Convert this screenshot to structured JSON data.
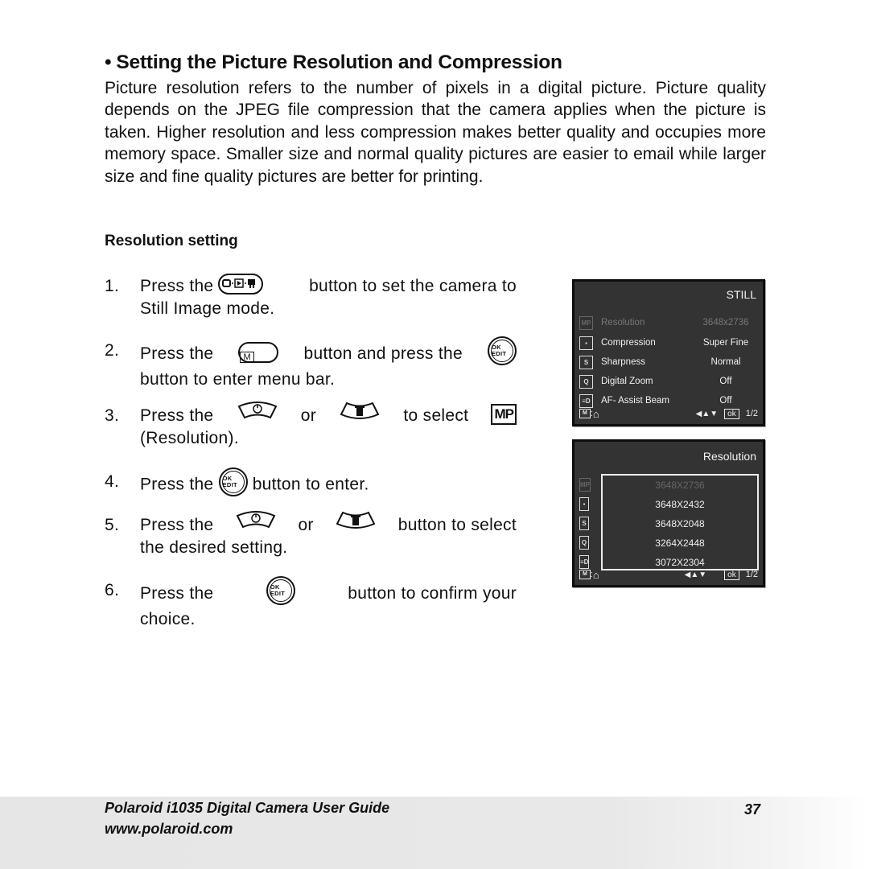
{
  "section": {
    "bullet": "•",
    "title": "Setting the Picture Resolution and Compression",
    "intro": "Picture resolution refers to the number of pixels in a digital picture. Picture quality depends on the JPEG file compression that the camera applies when the picture is taken. Higher resolution and less compression makes better quality and occupies more memory space. Smaller size and normal quality pictures are easier to email while larger size and fine quality pictures are better for printing."
  },
  "subsection": {
    "title": "Resolution setting"
  },
  "steps": [
    {
      "num": "1.",
      "a": "Press the",
      "icon": "mode-button-icon",
      "b": "button to set the camera to",
      "c": "Still Image mode."
    },
    {
      "num": "2.",
      "a": "Press the",
      "icon": "menu-m-button-icon",
      "b": "button and press the",
      "icon2": "ok-edit-button-icon",
      "c": "button to enter menu bar."
    },
    {
      "num": "3.",
      "a": "Press the",
      "icon": "up-arrow-timer-button-icon",
      "or": "or",
      "icon2": "down-arrow-trash-button-icon",
      "b": "to select",
      "icon3": "mp-resolution-icon",
      "c": "(Resolution)."
    },
    {
      "num": "4.",
      "a": "Press the",
      "icon": "ok-edit-button-icon",
      "b": "button to enter."
    },
    {
      "num": "5.",
      "a": "Press the",
      "icon": "up-arrow-timer-button-icon",
      "or": "or",
      "icon2": "down-arrow-trash-button-icon",
      "b": "button to select",
      "c": "the desired setting."
    },
    {
      "num": "6.",
      "a": "Press the",
      "icon": "ok-edit-button-icon",
      "b": "button to confirm your",
      "c": "choice."
    }
  ],
  "icon_text": {
    "ok_top": "OK",
    "ok_bottom": "EDIT",
    "m": "M",
    "mp": "MP"
  },
  "screen1": {
    "header": "STILL",
    "rows": [
      {
        "icon": "mp-icon",
        "icon_text": "MP",
        "label": "Resolution",
        "value": "3648x2736",
        "dimmed": true
      },
      {
        "icon": "compression-icon",
        "icon_text": "▪",
        "label": "Compression",
        "value": "Super Fine",
        "dimmed": false
      },
      {
        "icon": "sharpness-icon",
        "icon_text": "S",
        "label": "Sharpness",
        "value": "Normal",
        "dimmed": false
      },
      {
        "icon": "digital-zoom-icon",
        "icon_text": "Q",
        "label": "Digital Zoom",
        "value": "Off",
        "dimmed": false
      },
      {
        "icon": "af-assist-beam-icon",
        "icon_text": "≡D",
        "label": "AF- Assist Beam",
        "value": "Off",
        "dimmed": false
      }
    ],
    "footer": {
      "m": "M",
      "sep": ":",
      "home": "⌂",
      "nav": "◀▲▼",
      "ok": "ok",
      "page": "1/2"
    }
  },
  "screen2": {
    "header": "Resolution",
    "icons": [
      {
        "icon": "mp-icon",
        "icon_text": "MP",
        "dimmed": true
      },
      {
        "icon": "compression-icon",
        "icon_text": "▪",
        "dimmed": false
      },
      {
        "icon": "sharpness-icon",
        "icon_text": "S",
        "dimmed": false
      },
      {
        "icon": "digital-zoom-icon",
        "icon_text": "Q",
        "dimmed": false
      },
      {
        "icon": "af-assist-beam-icon",
        "icon_text": "≡D",
        "dimmed": false
      }
    ],
    "options": [
      {
        "label": "3648X2736",
        "selected": true
      },
      {
        "label": "3648X2432",
        "selected": false
      },
      {
        "label": "3648X2048",
        "selected": false
      },
      {
        "label": "3264X2448",
        "selected": false
      },
      {
        "label": "3072X2304",
        "selected": false
      }
    ],
    "footer": {
      "m": "M",
      "sep": ":",
      "home": "⌂",
      "nav": "◀▲▼",
      "ok": "ok",
      "page": "1/2"
    }
  },
  "footer": {
    "guide_title": "Polaroid i1035 Digital Camera User Guide",
    "url": "www.polaroid.com",
    "page_number": "37"
  }
}
